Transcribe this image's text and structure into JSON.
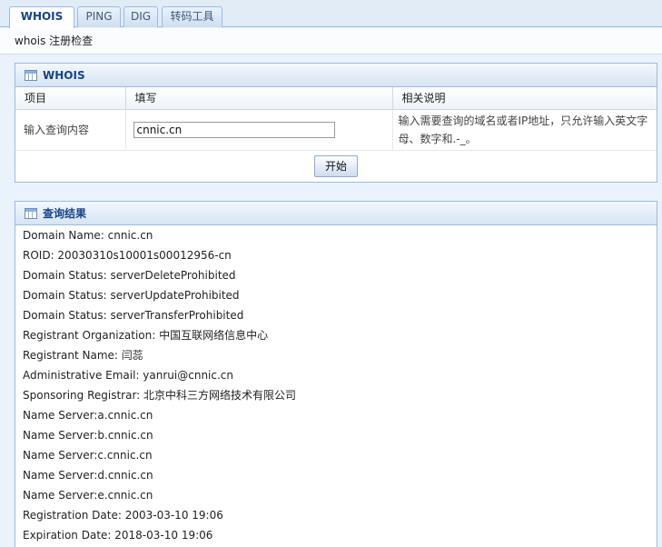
{
  "tabs": [
    {
      "label": "WHOIS"
    },
    {
      "label": "PING"
    },
    {
      "label": "DIG"
    },
    {
      "label": "转码工具"
    }
  ],
  "subheader": "whois 注册检查",
  "whois_panel": {
    "title": "WHOIS",
    "columns": [
      "项目",
      "填写",
      "相关说明"
    ],
    "row_label": "输入查询内容",
    "input_value": "cnnic.cn",
    "help_text": "输入需要查询的域名或者IP地址，只允许输入英文字母、数字和.-_。",
    "start_label": "开始"
  },
  "result_panel": {
    "title": "查询结果",
    "lines": [
      "Domain Name: cnnic.cn",
      "ROID: 20030310s10001s00012956-cn",
      "Domain Status: serverDeleteProhibited",
      "Domain Status: serverUpdateProhibited",
      "Domain Status: serverTransferProhibited",
      "Registrant Organization: 中国互联网络信息中心",
      "Registrant Name: 闫蕊",
      "Administrative Email: yanrui@cnnic.cn",
      "Sponsoring Registrar: 北京中科三方网络技术有限公司",
      "Name Server:a.cnnic.cn",
      "Name Server:b.cnnic.cn",
      "Name Server:c.cnnic.cn",
      "Name Server:d.cnnic.cn",
      "Name Server:e.cnnic.cn",
      "Registration Date: 2003-03-10 19:06",
      "Expiration Date: 2018-03-10 19:06"
    ]
  }
}
